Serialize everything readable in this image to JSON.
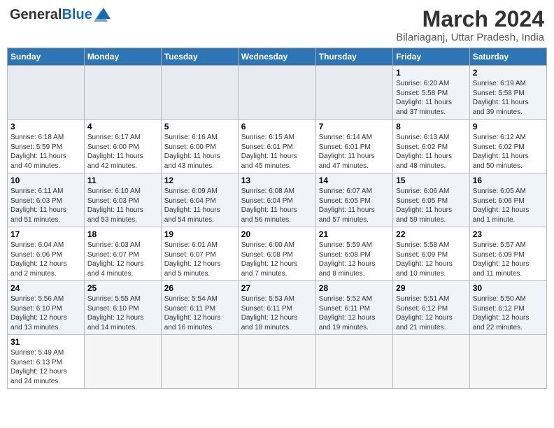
{
  "header": {
    "logo_general": "General",
    "logo_blue": "Blue",
    "month_year": "March 2024",
    "location": "Bilariaganj, Uttar Pradesh, India"
  },
  "weekdays": [
    "Sunday",
    "Monday",
    "Tuesday",
    "Wednesday",
    "Thursday",
    "Friday",
    "Saturday"
  ],
  "weeks": [
    [
      {
        "day": "",
        "info": ""
      },
      {
        "day": "",
        "info": ""
      },
      {
        "day": "",
        "info": ""
      },
      {
        "day": "",
        "info": ""
      },
      {
        "day": "",
        "info": ""
      },
      {
        "day": "1",
        "info": "Sunrise: 6:20 AM\nSunset: 5:58 PM\nDaylight: 11 hours\nand 37 minutes."
      },
      {
        "day": "2",
        "info": "Sunrise: 6:19 AM\nSunset: 5:58 PM\nDaylight: 11 hours\nand 39 minutes."
      }
    ],
    [
      {
        "day": "3",
        "info": "Sunrise: 6:18 AM\nSunset: 5:59 PM\nDaylight: 11 hours\nand 40 minutes."
      },
      {
        "day": "4",
        "info": "Sunrise: 6:17 AM\nSunset: 6:00 PM\nDaylight: 11 hours\nand 42 minutes."
      },
      {
        "day": "5",
        "info": "Sunrise: 6:16 AM\nSunset: 6:00 PM\nDaylight: 11 hours\nand 43 minutes."
      },
      {
        "day": "6",
        "info": "Sunrise: 6:15 AM\nSunset: 6:01 PM\nDaylight: 11 hours\nand 45 minutes."
      },
      {
        "day": "7",
        "info": "Sunrise: 6:14 AM\nSunset: 6:01 PM\nDaylight: 11 hours\nand 47 minutes."
      },
      {
        "day": "8",
        "info": "Sunrise: 6:13 AM\nSunset: 6:02 PM\nDaylight: 11 hours\nand 48 minutes."
      },
      {
        "day": "9",
        "info": "Sunrise: 6:12 AM\nSunset: 6:02 PM\nDaylight: 11 hours\nand 50 minutes."
      }
    ],
    [
      {
        "day": "10",
        "info": "Sunrise: 6:11 AM\nSunset: 6:03 PM\nDaylight: 11 hours\nand 51 minutes."
      },
      {
        "day": "11",
        "info": "Sunrise: 6:10 AM\nSunset: 6:03 PM\nDaylight: 11 hours\nand 53 minutes."
      },
      {
        "day": "12",
        "info": "Sunrise: 6:09 AM\nSunset: 6:04 PM\nDaylight: 11 hours\nand 54 minutes."
      },
      {
        "day": "13",
        "info": "Sunrise: 6:08 AM\nSunset: 6:04 PM\nDaylight: 11 hours\nand 56 minutes."
      },
      {
        "day": "14",
        "info": "Sunrise: 6:07 AM\nSunset: 6:05 PM\nDaylight: 11 hours\nand 57 minutes."
      },
      {
        "day": "15",
        "info": "Sunrise: 6:06 AM\nSunset: 6:05 PM\nDaylight: 11 hours\nand 59 minutes."
      },
      {
        "day": "16",
        "info": "Sunrise: 6:05 AM\nSunset: 6:06 PM\nDaylight: 12 hours\nand 1 minute."
      }
    ],
    [
      {
        "day": "17",
        "info": "Sunrise: 6:04 AM\nSunset: 6:06 PM\nDaylight: 12 hours\nand 2 minutes."
      },
      {
        "day": "18",
        "info": "Sunrise: 6:03 AM\nSunset: 6:07 PM\nDaylight: 12 hours\nand 4 minutes."
      },
      {
        "day": "19",
        "info": "Sunrise: 6:01 AM\nSunset: 6:07 PM\nDaylight: 12 hours\nand 5 minutes."
      },
      {
        "day": "20",
        "info": "Sunrise: 6:00 AM\nSunset: 6:08 PM\nDaylight: 12 hours\nand 7 minutes."
      },
      {
        "day": "21",
        "info": "Sunrise: 5:59 AM\nSunset: 6:08 PM\nDaylight: 12 hours\nand 8 minutes."
      },
      {
        "day": "22",
        "info": "Sunrise: 5:58 AM\nSunset: 6:09 PM\nDaylight: 12 hours\nand 10 minutes."
      },
      {
        "day": "23",
        "info": "Sunrise: 5:57 AM\nSunset: 6:09 PM\nDaylight: 12 hours\nand 11 minutes."
      }
    ],
    [
      {
        "day": "24",
        "info": "Sunrise: 5:56 AM\nSunset: 6:10 PM\nDaylight: 12 hours\nand 13 minutes."
      },
      {
        "day": "25",
        "info": "Sunrise: 5:55 AM\nSunset: 6:10 PM\nDaylight: 12 hours\nand 14 minutes."
      },
      {
        "day": "26",
        "info": "Sunrise: 5:54 AM\nSunset: 6:11 PM\nDaylight: 12 hours\nand 16 minutes."
      },
      {
        "day": "27",
        "info": "Sunrise: 5:53 AM\nSunset: 6:11 PM\nDaylight: 12 hours\nand 18 minutes."
      },
      {
        "day": "28",
        "info": "Sunrise: 5:52 AM\nSunset: 6:11 PM\nDaylight: 12 hours\nand 19 minutes."
      },
      {
        "day": "29",
        "info": "Sunrise: 5:51 AM\nSunset: 6:12 PM\nDaylight: 12 hours\nand 21 minutes."
      },
      {
        "day": "30",
        "info": "Sunrise: 5:50 AM\nSunset: 6:12 PM\nDaylight: 12 hours\nand 22 minutes."
      }
    ],
    [
      {
        "day": "31",
        "info": "Sunrise: 5:49 AM\nSunset: 6:13 PM\nDaylight: 12 hours\nand 24 minutes."
      },
      {
        "day": "",
        "info": ""
      },
      {
        "day": "",
        "info": ""
      },
      {
        "day": "",
        "info": ""
      },
      {
        "day": "",
        "info": ""
      },
      {
        "day": "",
        "info": ""
      },
      {
        "day": "",
        "info": ""
      }
    ]
  ]
}
